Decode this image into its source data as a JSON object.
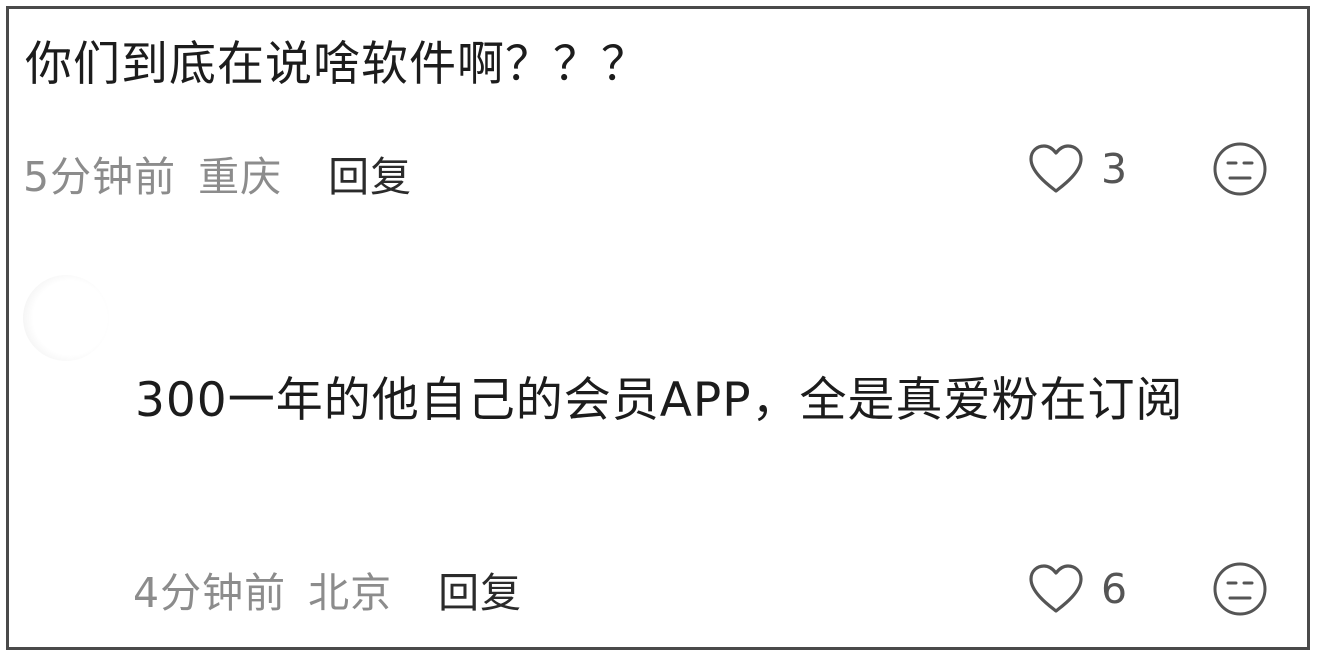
{
  "comments": [
    {
      "text": "你们到底在说啥软件啊？？？",
      "time": "5分钟前",
      "location": "重庆",
      "reply_label": "回复",
      "like_count": "3",
      "like_icon": "heart-outline-icon",
      "dislike_icon": "meh-face-icon"
    },
    {
      "text": "300一年的他自己的会员APP，全是真爱粉在订阅",
      "time": "4分钟前",
      "location": "北京",
      "reply_label": "回复",
      "like_count": "6",
      "like_icon": "heart-outline-icon",
      "dislike_icon": "meh-face-icon"
    }
  ],
  "colors": {
    "text": "#1c1c1c",
    "meta": "#8c8c8c",
    "reply": "#2b2b2b",
    "border": "#4a4a4a"
  }
}
